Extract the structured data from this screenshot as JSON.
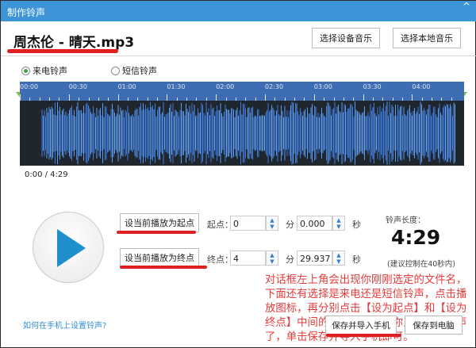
{
  "window": {
    "title": "制作铃声",
    "close_icon": "close-icon"
  },
  "file": {
    "name": "周杰伦 - 晴天.mp3"
  },
  "header_buttons": {
    "device_music": "选择设备音乐",
    "local_music": "选择本地音乐"
  },
  "ring_type": {
    "options": [
      "来电铃声",
      "短信铃声"
    ],
    "selected": "来电铃声"
  },
  "timeline": {
    "ticks": [
      "00:00",
      "00:30",
      "01:00",
      "01:30",
      "02:00",
      "02:30",
      "03:00",
      "03:30",
      "04:00"
    ]
  },
  "playback": {
    "time": "0:00 / 4:29"
  },
  "start": {
    "button": "设当前播放为起点",
    "label": "起点：",
    "minutes": "0",
    "min_unit": "分",
    "seconds": "0.000",
    "sec_unit": "秒"
  },
  "end": {
    "button": "设当前播放为终点",
    "label": "终点：",
    "minutes": "4",
    "min_unit": "分",
    "seconds": "29.937",
    "sec_unit": "秒"
  },
  "length": {
    "label": "铃声长度：",
    "value": "4:29",
    "hint": "(建议控制在40秒内)"
  },
  "annotation": "对话框左上角会出现你刚刚选定的文件名，下面还有选择是来电还是短信铃声，点击播放图标，再分别点击【设为起点】和【设为终点】中间的音乐部分就是你只做好的铃声了，单击保存并导入手机即可。",
  "footer": {
    "help_link": "如何在手机上设置铃声?",
    "save_import": "保存并导入手机",
    "save_pc": "保存到电脑"
  },
  "colors": {
    "titlebar": "#3d95d8",
    "timeline": "#3e6db4",
    "waveform": "#3b7de0",
    "annotation": "#e23b3b",
    "underline": "#e02020"
  }
}
